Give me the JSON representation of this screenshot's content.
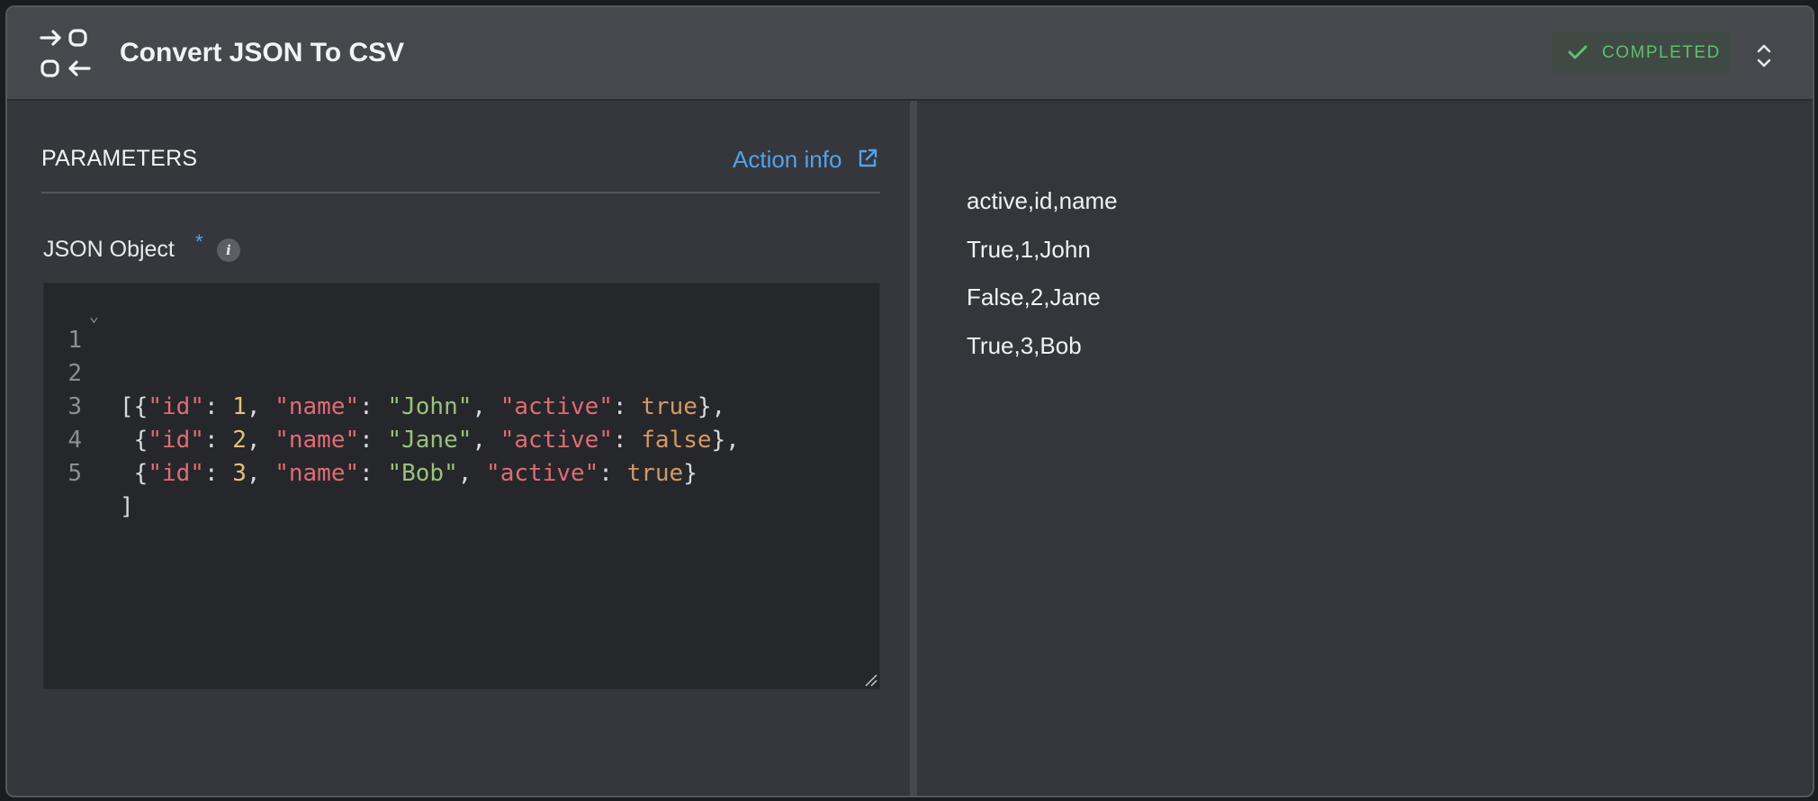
{
  "header": {
    "icon": "swap-arrows-icon",
    "title": "Convert JSON To CSV",
    "status": "COMPLETED",
    "status_color": "#5fbf6f",
    "expand_icon": "chevron-up-down-icon"
  },
  "parameters": {
    "heading": "PARAMETERS",
    "action_info": "Action info",
    "action_info_color": "#4fa3ef",
    "field_label": "JSON Object",
    "required_marker": "*",
    "info_icon": "i"
  },
  "editor": {
    "line_numbers": [
      "1",
      "2",
      "3",
      "4",
      "5"
    ],
    "lines": [
      "[",
      " {\"id\": 1, \"name\": \"John\", \"active\": true},",
      " {\"id\": 2, \"name\": \"Jane\", \"active\": false},",
      " {\"id\": 3, \"name\": \"Bob\", \"active\": true}",
      "]"
    ]
  },
  "output": {
    "lines": [
      "active,id,name",
      "True,1,John",
      "False,2,Jane",
      "True,3,Bob"
    ]
  }
}
